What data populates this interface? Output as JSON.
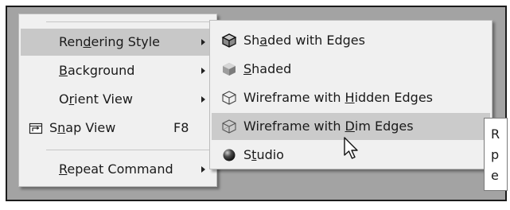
{
  "main_menu": {
    "items": [
      {
        "pre": "Ren",
        "mn": "d",
        "post": "ering Style",
        "shortcut": "",
        "submenu": true
      },
      {
        "pre": "",
        "mn": "B",
        "post": "ackground",
        "shortcut": "",
        "submenu": true
      },
      {
        "pre": "O",
        "mn": "r",
        "post": "ient View",
        "shortcut": "",
        "submenu": true
      },
      {
        "pre": "S",
        "mn": "n",
        "post": "ap View",
        "shortcut": "F8",
        "submenu": false
      },
      {
        "pre": "",
        "mn": "R",
        "post": "epeat Command",
        "shortcut": "",
        "submenu": true
      }
    ],
    "icons": {
      "snap_view": "snap-view-icon"
    }
  },
  "rendering_submenu": {
    "items": [
      {
        "pre": "Sh",
        "mn": "a",
        "post": "ded with Edges",
        "icon": "shaded-with-edges-icon"
      },
      {
        "pre": "",
        "mn": "S",
        "post": "haded",
        "icon": "shaded-icon"
      },
      {
        "pre": "Wireframe with ",
        "mn": "H",
        "post": "idden Edges",
        "icon": "wireframe-hidden-icon"
      },
      {
        "pre": "Wireframe with ",
        "mn": "D",
        "post": "im Edges",
        "icon": "wireframe-dim-icon"
      },
      {
        "pre": "S",
        "mn": "t",
        "post": "udio",
        "icon": "studio-icon"
      }
    ],
    "highlighted_index": 3
  },
  "tooltip": {
    "lines": [
      "R",
      "p",
      "e"
    ]
  },
  "colors": {
    "menu_bg": "#f0f0f0",
    "highlight": "#c8c8c8",
    "backdrop": "#a3a3a3",
    "frame": "#1b1b1b"
  }
}
